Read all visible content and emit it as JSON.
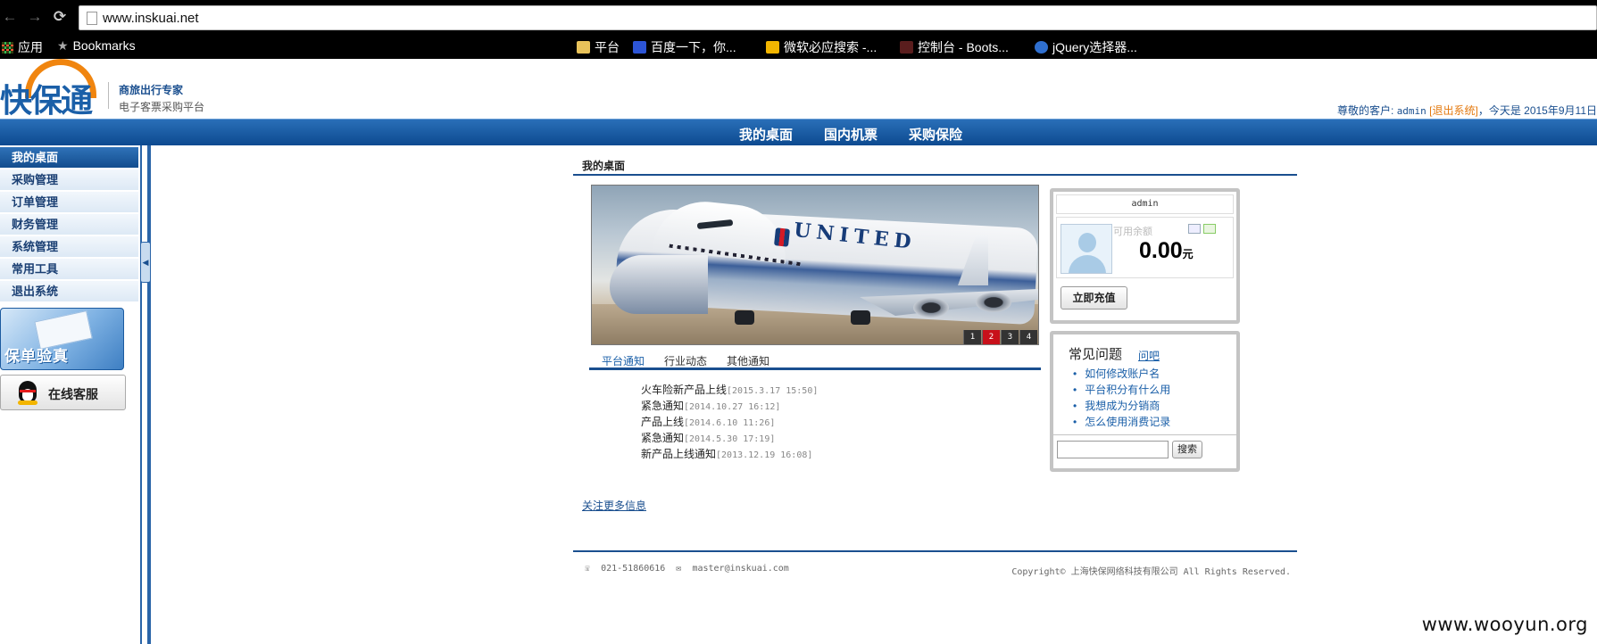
{
  "browser": {
    "url": "www.inskuai.net",
    "bookmarks": [
      "应用",
      "Bookmarks",
      "平台",
      "百度一下，你...",
      "微软必应搜索 -...",
      "控制台 - Boots...",
      "jQuery选择器..."
    ]
  },
  "header": {
    "logo_text": "快保通",
    "slogan_line1": "商旅出行专家",
    "slogan_line2": "电子客票采购平台",
    "greeting_prefix": "尊敬的客户: ",
    "username": "admin",
    "logout": "[退出系统]",
    "date_text": "，今天是 2015年9月11日"
  },
  "main_nav": [
    "我的桌面",
    "国内机票",
    "采购保险"
  ],
  "sidebar": {
    "items": [
      "我的桌面",
      "采购管理",
      "订单管理",
      "财务管理",
      "系统管理",
      "常用工具",
      "退出系统"
    ],
    "active_index": 0,
    "policy_banner": "保单验真",
    "service": "在线客服"
  },
  "content": {
    "page_title": "我的桌面",
    "carousel": {
      "livery": "UNITED",
      "pages": [
        "1",
        "2",
        "3",
        "4"
      ],
      "active_page": "2"
    },
    "news_tabs": [
      "平台通知",
      "行业动态",
      "其他通知"
    ],
    "news": [
      {
        "title": "火车险新产品上线",
        "date": "[2015.3.17 15:50]"
      },
      {
        "title": "紧急通知",
        "date": "[2014.10.27 16:12]"
      },
      {
        "title": "产品上线",
        "date": "[2014.6.10 11:26]"
      },
      {
        "title": "紧急通知",
        "date": "[2014.5.30 17:19]"
      },
      {
        "title": "新产品上线通知",
        "date": "[2013.12.19 16:08]"
      }
    ],
    "more_link": "关注更多信息"
  },
  "account": {
    "username": "admin",
    "balance_label": "可用余额",
    "balance": "0.00",
    "unit": "元",
    "recharge_btn": "立即充值"
  },
  "faq": {
    "title": "常见问题",
    "ask_link": "问吧",
    "items": [
      "如何修改账户名",
      "平台积分有什么用",
      "我想成为分销商",
      "怎么使用消费记录"
    ],
    "search_btn": "搜索",
    "search_value": ""
  },
  "footer": {
    "phone": "021-51860616",
    "email": "master@inskuai.com",
    "copyright": "Copyright© 上海快保网络科技有限公司 All Rights Reserved."
  },
  "watermark": "www.wooyun.org"
}
